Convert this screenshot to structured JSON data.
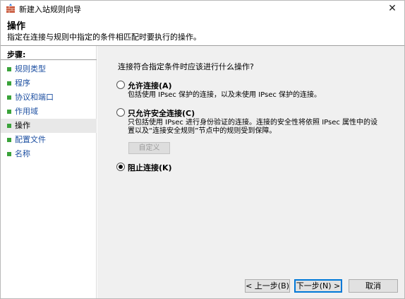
{
  "window": {
    "title": "新建入站规则向导",
    "close_symbol": "✕"
  },
  "header": {
    "title": "操作",
    "description": "指定在连接与规则中指定的条件相匹配时要执行的操作。"
  },
  "sidebar": {
    "heading": "步骤:",
    "items": [
      {
        "label": "规则类型"
      },
      {
        "label": "程序"
      },
      {
        "label": "协议和端口"
      },
      {
        "label": "作用域"
      },
      {
        "label": "操作"
      },
      {
        "label": "配置文件"
      },
      {
        "label": "名称"
      }
    ],
    "current_index": 4
  },
  "main": {
    "question": "连接符合指定条件时应该进行什么操作?",
    "options": [
      {
        "label": "允许连接(A)",
        "desc_lines": [
          "包括使用 IPsec 保护的连接，以及未使用 IPsec 保护的连接。"
        ],
        "checked": false
      },
      {
        "label": "只允许安全连接(C)",
        "desc_lines": [
          "只包括使用 IPsec 进行身份验证的连接。连接的安全性将依照 IPsec 属性中的设",
          "置以及“连接安全规则”节点中的规则受到保障。"
        ],
        "checked": false
      },
      {
        "label": "阻止连接(K)",
        "desc_lines": [],
        "checked": true
      }
    ],
    "custom_button": "自定义"
  },
  "footer": {
    "back": "< 上一步(B)",
    "next": "下一步(N) >",
    "cancel": "取消"
  },
  "colors": {
    "link": "#1e50a2",
    "bullet": "#3aa33a",
    "panel_bg": "#f0f0f0",
    "default_button_border": "#0078d7"
  }
}
